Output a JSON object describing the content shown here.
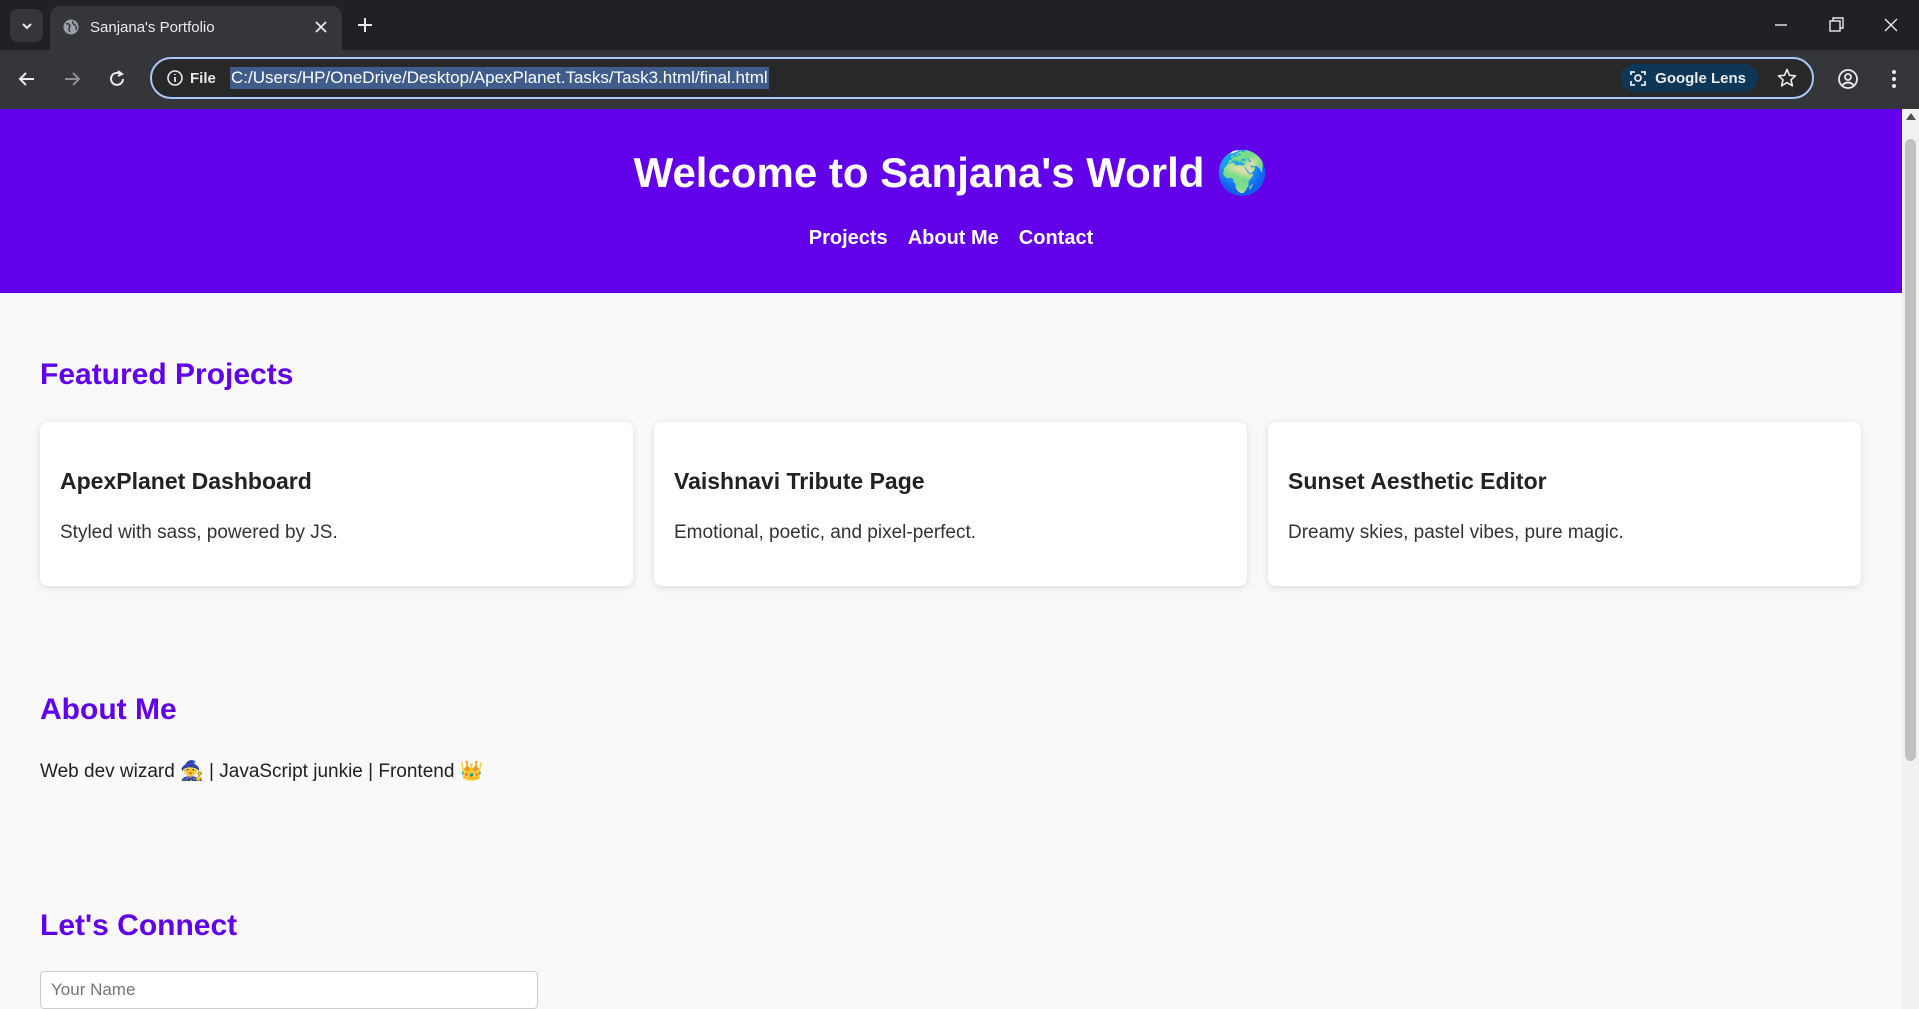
{
  "browser": {
    "tab_title": "Sanjana's Portfolio",
    "site_info_label": "File",
    "url": "C:/Users/HP/OneDrive/Desktop/ApexPlanet.Tasks/Task3.html/final.html",
    "lens_label": "Google Lens"
  },
  "header": {
    "title": "Welcome to Sanjana's World 🌍",
    "nav": [
      "Projects",
      "About Me",
      "Contact"
    ]
  },
  "projects": {
    "heading": "Featured Projects",
    "cards": [
      {
        "title": "ApexPlanet Dashboard",
        "desc": "Styled with sass, powered by JS."
      },
      {
        "title": "Vaishnavi Tribute Page",
        "desc": "Emotional, poetic, and pixel-perfect."
      },
      {
        "title": "Sunset Aesthetic Editor",
        "desc": "Dreamy skies, pastel vibes, pure magic."
      }
    ]
  },
  "about": {
    "heading": "About Me",
    "text": "Web dev wizard 🧙 | JavaScript junkie | Frontend 👑"
  },
  "contact": {
    "heading": "Let's Connect",
    "name_placeholder": "Your Name"
  },
  "colors": {
    "accent": "#6200ea",
    "page_bg": "#f9f9f9"
  }
}
